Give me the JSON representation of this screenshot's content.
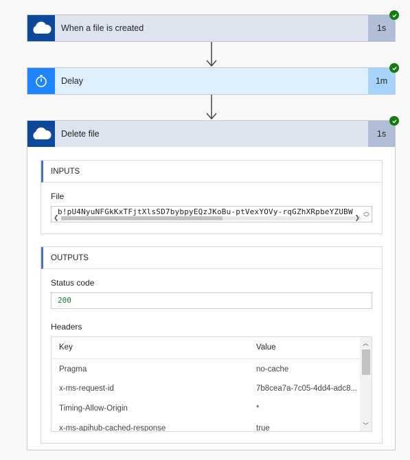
{
  "steps": [
    {
      "title": "When a file is created",
      "duration": "1s",
      "icon": "onedrive-cloud-icon",
      "color": "#0e4a9c"
    },
    {
      "title": "Delay",
      "duration": "1m",
      "icon": "timer-icon",
      "color": "#1f85ff"
    },
    {
      "title": "Delete file",
      "duration": "1s",
      "icon": "onedrive-cloud-icon",
      "color": "#0e4a9c"
    }
  ],
  "inputs": {
    "section_label": "INPUTS",
    "file_label": "File",
    "file_value": "b!pU4NyuNFGkKxTFjtXlsSD7bybpyEQzJKoBu-ptVexYOVy-rqGZhXRpbeYZUBW"
  },
  "outputs": {
    "section_label": "OUTPUTS",
    "status_label": "Status code",
    "status_value": "200",
    "headers_label": "Headers",
    "columns": [
      "Key",
      "Value"
    ],
    "rows": [
      {
        "key": "Pragma",
        "value": "no-cache"
      },
      {
        "key": "x-ms-request-id",
        "value": "7b8cea7a-7c05-4dd4-adc8..."
      },
      {
        "key": "Timing-Allow-Origin",
        "value": "*"
      },
      {
        "key": "x-ms-apihub-cached-response",
        "value": "true"
      }
    ]
  },
  "status_color": "#107c10"
}
